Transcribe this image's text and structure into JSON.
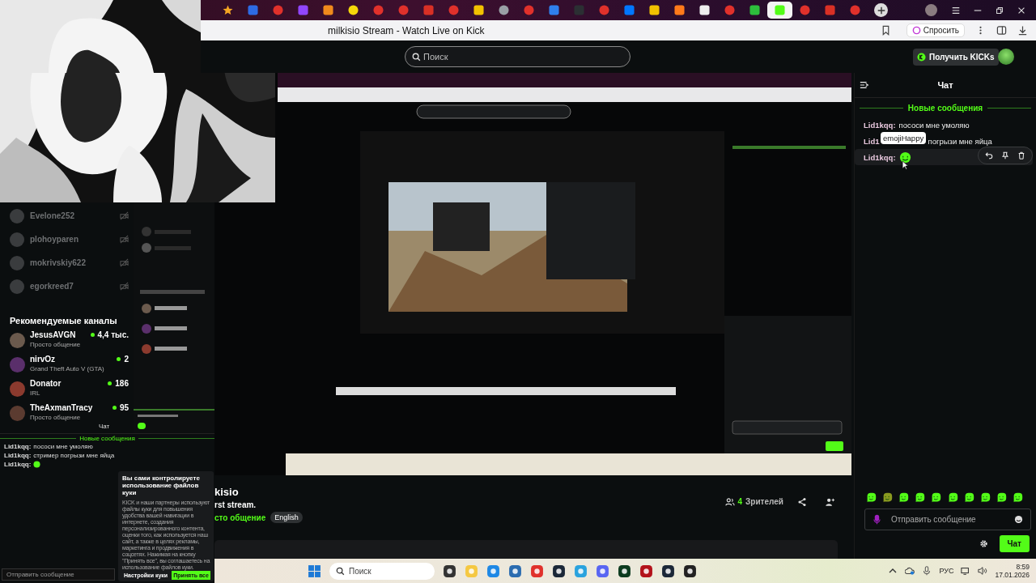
{
  "browser": {
    "tabs": [
      {
        "kind": "star",
        "color": "#f5a623",
        "selected": false
      },
      {
        "kind": "square",
        "color": "#2d6be4",
        "selected": false
      },
      {
        "kind": "circle",
        "color": "#e0312b",
        "selected": false
      },
      {
        "kind": "square",
        "color": "#9146ff",
        "selected": false
      },
      {
        "kind": "square",
        "color": "#f08a1c",
        "selected": false
      },
      {
        "kind": "circle",
        "color": "#f5d90a",
        "selected": false
      },
      {
        "kind": "circle",
        "color": "#e0312b",
        "selected": false
      },
      {
        "kind": "circle",
        "color": "#e0312b",
        "selected": false
      },
      {
        "kind": "square",
        "color": "#d93025",
        "selected": false
      },
      {
        "kind": "circle",
        "color": "#e0312b",
        "selected": false
      },
      {
        "kind": "square",
        "color": "#f2c200",
        "selected": false
      },
      {
        "kind": "circle",
        "color": "#9aa0a6",
        "selected": false
      },
      {
        "kind": "circle",
        "color": "#e0312b",
        "selected": false
      },
      {
        "kind": "square",
        "color": "#2f80ed",
        "selected": false
      },
      {
        "kind": "square",
        "color": "#2b2f33",
        "selected": false
      },
      {
        "kind": "circle",
        "color": "#e0312b",
        "selected": false
      },
      {
        "kind": "square",
        "color": "#0077ff",
        "selected": false
      },
      {
        "kind": "square",
        "color": "#f2c200",
        "selected": false
      },
      {
        "kind": "square",
        "color": "#ff7a1a",
        "selected": false
      },
      {
        "kind": "square",
        "color": "#eeeeee",
        "selected": false
      },
      {
        "kind": "circle",
        "color": "#e0312b",
        "selected": false
      },
      {
        "kind": "square",
        "color": "#2dbe3c",
        "selected": false
      },
      {
        "kind": "square",
        "color": "#53fc18",
        "selected": true
      },
      {
        "kind": "circle",
        "color": "#e0312b",
        "selected": false
      },
      {
        "kind": "square",
        "color": "#d93025",
        "selected": false
      },
      {
        "kind": "circle",
        "color": "#e0312b",
        "selected": false
      }
    ],
    "title": "milkisio Stream - Watch Live on Kick",
    "ask_button": "Спросить"
  },
  "header": {
    "search": {
      "placeholder": "Поиск"
    },
    "kicks_button": "Получить KICKs"
  },
  "sidebar": {
    "followed": [
      {
        "name": "Evelone252"
      },
      {
        "name": "plohoyparen"
      },
      {
        "name": "mokrivskiy622"
      },
      {
        "name": "egorkreed7"
      }
    ],
    "recommended_title": "Рекомендуемые каналы",
    "recommended": [
      {
        "name": "JesusAVGN",
        "category": "Просто общение",
        "viewers": "4,4 тыс."
      },
      {
        "name": "nirvOz",
        "category": "Grand Theft Auto V (GTA)",
        "viewers": "2"
      },
      {
        "name": "Donator",
        "category": "IRL",
        "viewers": "186"
      },
      {
        "name": "TheAxmanTracy",
        "category": "Просто общение",
        "viewers": "95"
      }
    ]
  },
  "mini_chat": {
    "label": "Чат",
    "divider": "Новые сообщения",
    "messages": [
      {
        "kind": "text",
        "user": "Lid1kqq:",
        "text": "пососи мне умоляю"
      },
      {
        "kind": "text",
        "user": "Lid1kqq:",
        "text": "стример погрызи мне яйца"
      },
      {
        "kind": "emote",
        "user": "Lid1kqq:"
      }
    ],
    "input": {
      "placeholder": "Отправить сообщение"
    }
  },
  "cookie_banner": {
    "title": "Вы сами контролируете использование файлов куки",
    "body": "KICK и наши партнеры используют файлы куки для повышения удобства вашей навигации в интернете, создания персонализированного контента, оценки того, как используется наш сайт, а также в целях рекламы, маркетинга и продвижения в соцсетях. Нажимая на кнопку \"Принять все\", вы соглашаетесь на использование файлов куки.",
    "buttons": [
      "Настройки куки",
      "Принять все"
    ]
  },
  "stream": {
    "title": "kisio",
    "description": "rst stream.",
    "category": "сто общение",
    "tag": "English",
    "viewer_count": "4",
    "viewer_label": "Зрителей"
  },
  "chat": {
    "title": "Чат",
    "divider": "Новые сообщения",
    "messages": [
      {
        "kind": "text",
        "user": "Lid1kqq:",
        "text": "пососи мне умоляю",
        "hovered": false
      },
      {
        "kind": "text",
        "user": "Lid1",
        "text": "погрызи мне яйца",
        "hovered": false
      },
      {
        "kind": "emote",
        "user": "Lid1kqq:",
        "hovered": true
      }
    ],
    "tooltip": "emojiHappy",
    "input": {
      "placeholder": "Отправить сообщение"
    },
    "send_button": "Чат"
  },
  "taskbar": {
    "search": {
      "placeholder": "Поиск"
    },
    "language": "РУС",
    "time": "8:59",
    "date": "17.01.2026"
  }
}
